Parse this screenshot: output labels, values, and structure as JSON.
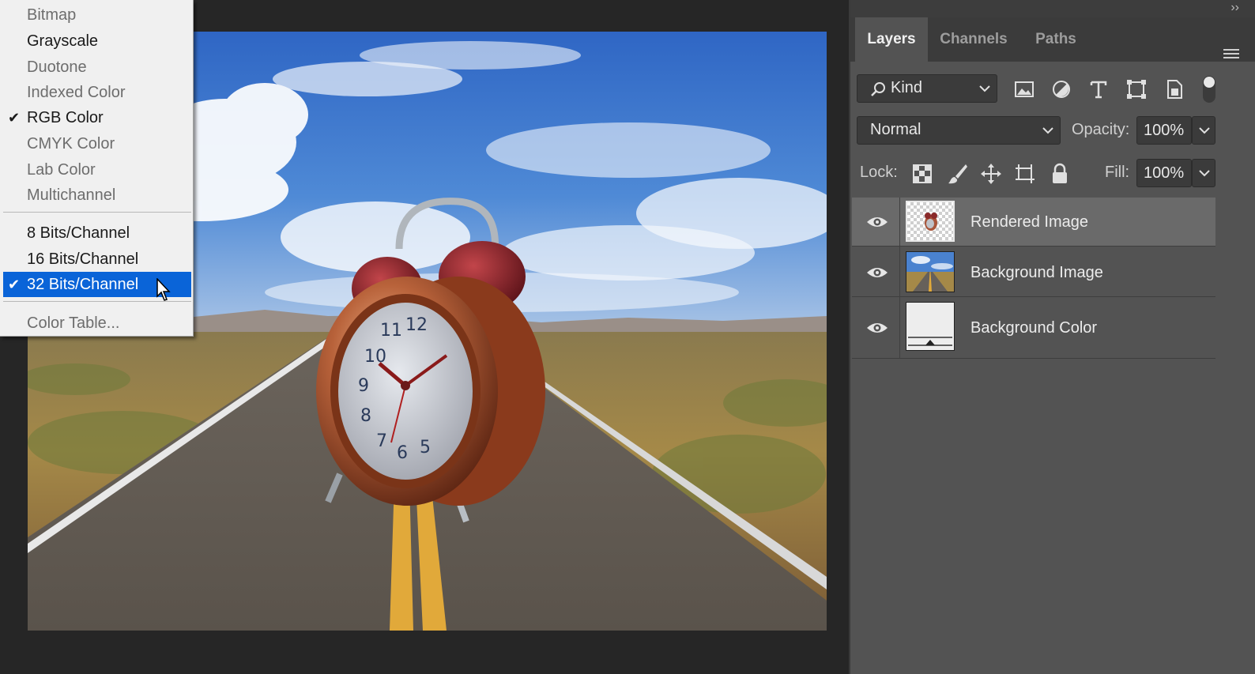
{
  "mode_menu": {
    "items": [
      {
        "label": "Bitmap",
        "enabled": false,
        "checked": false
      },
      {
        "label": "Grayscale",
        "enabled": true,
        "checked": false
      },
      {
        "label": "Duotone",
        "enabled": false,
        "checked": false
      },
      {
        "label": "Indexed Color",
        "enabled": false,
        "checked": false
      },
      {
        "label": "RGB Color",
        "enabled": true,
        "checked": true
      },
      {
        "label": "CMYK Color",
        "enabled": false,
        "checked": false
      },
      {
        "label": "Lab Color",
        "enabled": false,
        "checked": false
      },
      {
        "label": "Multichannel",
        "enabled": false,
        "checked": false
      },
      {
        "label": "8 Bits/Channel",
        "enabled": true,
        "checked": false
      },
      {
        "label": "16 Bits/Channel",
        "enabled": true,
        "checked": false
      },
      {
        "label": "32 Bits/Channel",
        "enabled": true,
        "checked": true,
        "highlighted": true
      },
      {
        "label": "Color Table...",
        "enabled": false,
        "checked": false
      }
    ],
    "check_glyph": "✔"
  },
  "panel": {
    "collapse_glyph": "››",
    "tabs": [
      {
        "label": "Layers",
        "active": true
      },
      {
        "label": "Channels",
        "active": false
      },
      {
        "label": "Paths",
        "active": false
      }
    ],
    "filter": {
      "value": "Kind",
      "icons": [
        "image-filter-icon",
        "adjustment-filter-icon",
        "type-filter-icon",
        "shape-filter-icon",
        "smart-object-filter-icon"
      ]
    },
    "blend_mode": "Normal",
    "opacity_label": "Opacity:",
    "opacity_value": "100%",
    "lock_label": "Lock:",
    "lock_icons": [
      "lock-transparent-pixels-icon",
      "lock-image-pixels-icon",
      "lock-position-icon",
      "lock-artboard-icon",
      "lock-all-icon"
    ],
    "fill_label": "Fill:",
    "fill_value": "100%",
    "layers": [
      {
        "name": "Rendered Image",
        "visible": true,
        "selected": true
      },
      {
        "name": "Background Image",
        "visible": true,
        "selected": false
      },
      {
        "name": "Background Color",
        "visible": true,
        "selected": false
      }
    ]
  },
  "colors": {
    "menu_highlight": "#0a64d8",
    "panel_bg": "#535353",
    "selected_layer": "#6a6a6a"
  }
}
